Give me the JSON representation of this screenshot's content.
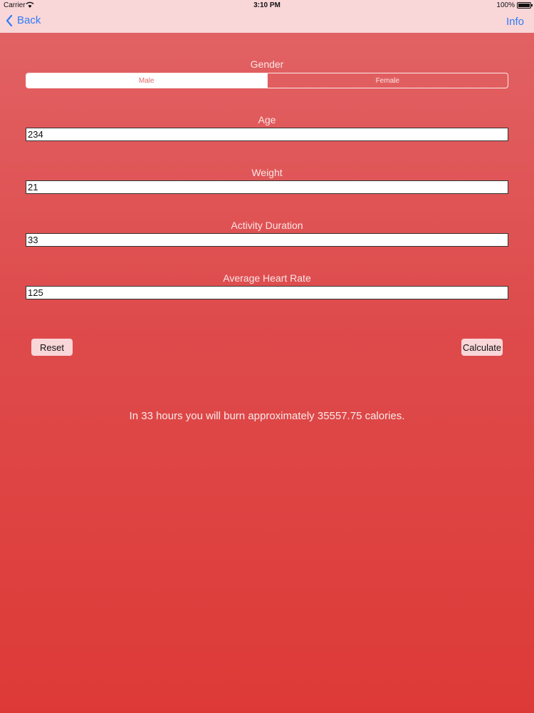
{
  "status_bar": {
    "carrier": "Carrier",
    "time": "3:10 PM",
    "battery": "100%"
  },
  "nav": {
    "back_label": "Back",
    "info_label": "Info"
  },
  "form": {
    "gender_label": "Gender",
    "gender_options": [
      "Male",
      "Female"
    ],
    "gender_selected": "Male",
    "age_label": "Age",
    "age_value": "234",
    "weight_label": "Weight",
    "weight_value": "21",
    "duration_label": "Activity Duration",
    "duration_value": "33",
    "heart_rate_label": "Average Heart Rate",
    "heart_rate_value": "125"
  },
  "buttons": {
    "reset_label": "Reset",
    "calculate_label": "Calculate"
  },
  "result_text": "In 33 hours you will burn approximately 35557.75 calories.",
  "colors": {
    "nav_bar": "#f9d6d8",
    "link": "#2f7cf6",
    "background_top": "#e26466",
    "background_bottom": "#dd3a37"
  }
}
